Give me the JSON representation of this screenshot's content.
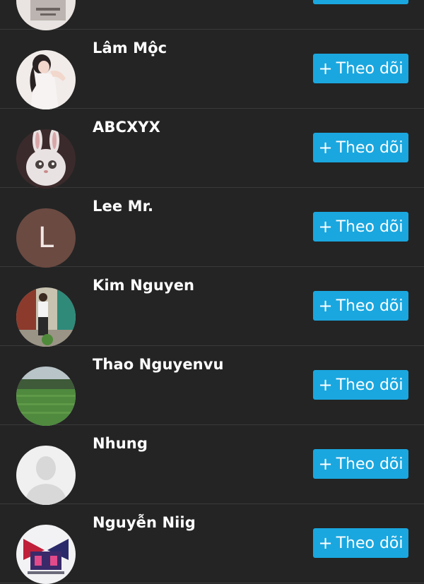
{
  "follow_label": "Theo dõi",
  "plus_symbol": "+",
  "accent_color": "#1aa7df",
  "users": [
    {
      "name": "",
      "avatar": "photo-partial"
    },
    {
      "name": "Lâm Mộc",
      "avatar": "photo-woman"
    },
    {
      "name": "ABCXYX",
      "avatar": "photo-bunny"
    },
    {
      "name": "Lee Mr.",
      "avatar": "letter",
      "initial": "L",
      "avatar_color": "#6b4a42"
    },
    {
      "name": "Kim Nguyen",
      "avatar": "photo-man"
    },
    {
      "name": "Thao Nguyenvu",
      "avatar": "photo-field"
    },
    {
      "name": "Nhung",
      "avatar": "default-silhouette"
    },
    {
      "name": "Nguyễn Niig",
      "avatar": "photo-logo"
    }
  ]
}
